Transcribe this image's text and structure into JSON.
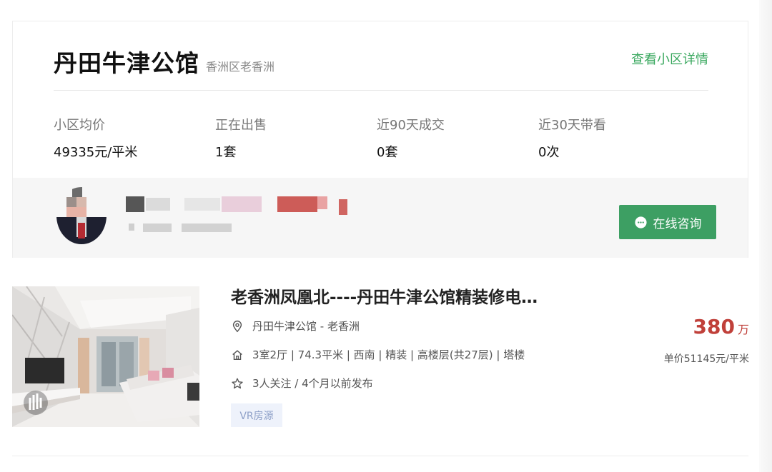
{
  "community": {
    "name": "丹田牛津公馆",
    "district": "香洲区老香洲",
    "detail_link": "查看小区详情"
  },
  "stats": [
    {
      "label": "小区均价",
      "value": "49335元/平米"
    },
    {
      "label": "正在出售",
      "value": "1套"
    },
    {
      "label": "近90天成交",
      "value": "0套"
    },
    {
      "label": "近30天带看",
      "value": "0次"
    }
  ],
  "agent": {
    "consult_label": "在线咨询",
    "consult_icon": "chat-bubble-icon"
  },
  "listing": {
    "title": "老香洲凤凰北----丹田牛津公馆精装修电…",
    "location": "丹田牛津公馆 - 老香洲",
    "attributes": "3室2厅 | 74.3平米 | 西南 | 精装 | 高楼层(共27层) | 塔楼",
    "follow": "3人关注 / 4个月以前发布",
    "tag": "VR房源",
    "price": "380",
    "price_unit": "万",
    "unit_price": "单价51145元/平米"
  },
  "colors": {
    "accent_green": "#3aa85f",
    "button_green": "#3d9f63",
    "price_red": "#c0403a",
    "tag_bg": "#eef2fb"
  }
}
